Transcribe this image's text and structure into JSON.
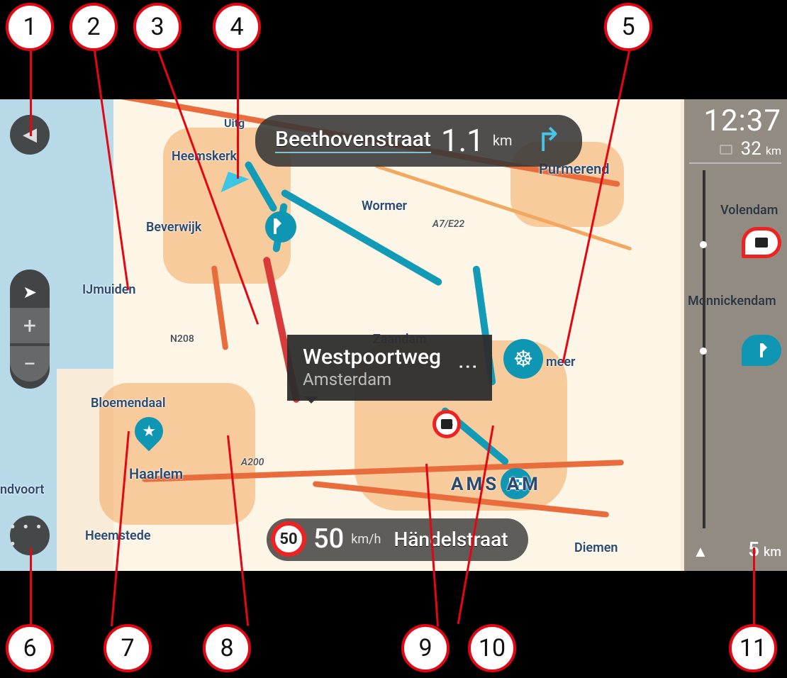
{
  "domain": "Diagram",
  "instruction": {
    "road": "Beethovenstraat",
    "distance_value": "1.1",
    "distance_unit": "km",
    "maneuver": "turn-right"
  },
  "selected_location": {
    "name": "Westpoortweg",
    "city": "Amsterdam"
  },
  "speed_panel": {
    "limit": "50",
    "current_speed": "50",
    "speed_unit": "km/h",
    "street": "Händelstraat"
  },
  "arrival": {
    "time": "12:37",
    "remaining_value": "32",
    "remaining_unit": "km"
  },
  "routebar": {
    "current_marker_distance_value": "5",
    "current_marker_distance_unit": "km",
    "events": [
      {
        "type": "speed-camera"
      },
      {
        "type": "waypoint"
      }
    ]
  },
  "map_labels": {
    "heemskerk": "Heemskerk",
    "beverwijk": "Beverwijk",
    "ijmuiden": "IJmuiden",
    "bloemendaal": "Bloemendaal",
    "haarlem": "Haarlem",
    "heemstede": "Heemstede",
    "ndvoort": "ndvoort",
    "uitg": "Uitg",
    "wormer": "Wormer",
    "zaandam": "Zaandam",
    "purmerend": "Purmerend",
    "volendam": "Volendam",
    "monnickendam": "Monnickendam",
    "amsterdam_big": "AMS        AM",
    "diemen": "Diemen",
    "meer_partial": "meer",
    "n208": "N208",
    "a200": "A200",
    "a7e22": "A7/E22"
  },
  "callouts": {
    "c1": "1",
    "c2": "2",
    "c3": "3",
    "c4": "4",
    "c5": "5",
    "c6": "6",
    "c7": "7",
    "c8": "8",
    "c9": "9",
    "c10": "10",
    "c11": "11"
  },
  "controls": {
    "zoom_in": "+",
    "zoom_out": "−",
    "menu_dots": "• • • •"
  }
}
